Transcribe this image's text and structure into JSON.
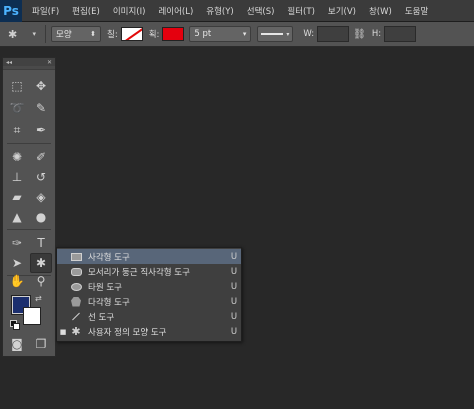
{
  "app": {
    "logo": "Ps"
  },
  "menu": [
    "파일(F)",
    "편집(E)",
    "이미지(I)",
    "레이어(L)",
    "유형(Y)",
    "선택(S)",
    "필터(T)",
    "보기(V)",
    "창(W)",
    "도움말"
  ],
  "options": {
    "shape_mode": "모양",
    "fill_label": "칠:",
    "stroke_label": "획:",
    "stroke_width": "5 pt",
    "w_label": "W:",
    "h_label": "H:"
  },
  "tools_panel": {
    "collapse_glyph": "◂◂",
    "close_glyph": "✕"
  },
  "flyout": {
    "items": [
      {
        "label": "사각형 도구",
        "shortcut": "U",
        "icon": "rectangle-icon",
        "selected": true,
        "checked": false
      },
      {
        "label": "모서리가 둥근 직사각형 도구",
        "shortcut": "U",
        "icon": "rounded-rectangle-icon",
        "selected": false,
        "checked": false
      },
      {
        "label": "타원 도구",
        "shortcut": "U",
        "icon": "ellipse-icon",
        "selected": false,
        "checked": false
      },
      {
        "label": "다각형 도구",
        "shortcut": "U",
        "icon": "polygon-icon",
        "selected": false,
        "checked": false
      },
      {
        "label": "선 도구",
        "shortcut": "U",
        "icon": "line-icon",
        "selected": false,
        "checked": false
      },
      {
        "label": "사용자 정의 모양 도구",
        "shortcut": "U",
        "icon": "custom-shape-icon",
        "selected": false,
        "checked": true
      }
    ]
  },
  "colors": {
    "foreground": "#1b2e6e",
    "background": "#ffffff",
    "fill_swatch": "none",
    "stroke_swatch": "#e4000e",
    "menu_highlight": "#586679"
  }
}
